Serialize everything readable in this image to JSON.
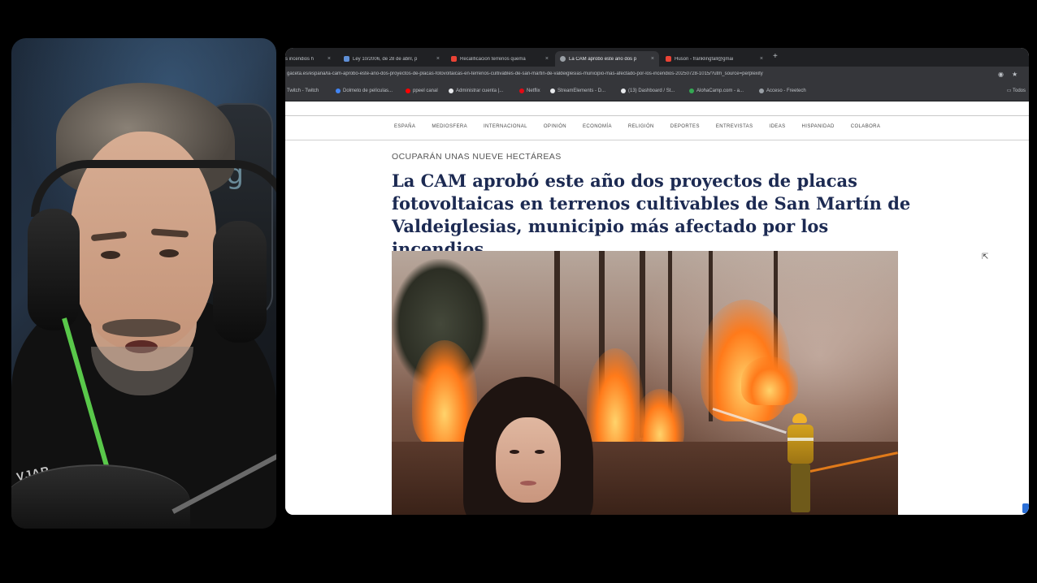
{
  "browser": {
    "tabs": [
      {
        "label": "s incendios h",
        "color": "#9aa0a6",
        "active": false
      },
      {
        "label": "Ley 10/2006, de 28 de abril, p",
        "color": "#5f8fd6",
        "active": false
      },
      {
        "label": "Recalificacion terrenos quema",
        "color": "#ea4335",
        "active": false
      },
      {
        "label": "La CAM aprobó este año dos p",
        "color": "#9aa0a6",
        "active": true
      },
      {
        "label": "Huson - franklingfall@gmai",
        "color": "#ea4335",
        "active": false
      }
    ],
    "close_glyph": "×",
    "new_tab_glyph": "+",
    "url": "gaceta.es/espana/la-cam-aprobo-este-ano-dos-proyectos-de-placas-fotovoltaicas-en-terrenos-cultivables-de-san-martin-de-valdeiglesias-municipio-mas-afectado-por-los-incendios-20250728-1015/?utm_source=perplexity",
    "bookmarks": [
      {
        "label": "Twitch - Twitch",
        "color": "#9146ff"
      },
      {
        "label": "Dolmeto de películas...",
        "color": "#4285f4"
      },
      {
        "label": "ppeel canal",
        "color": "#ff0000"
      },
      {
        "label": "Administrar cuenta |...",
        "color": "#e8eaed"
      },
      {
        "label": "Netflix",
        "color": "#e50914"
      },
      {
        "label": "StreamElements - D...",
        "color": "#e8eaed"
      },
      {
        "label": "(13) Dashboard / St...",
        "color": "#e8eaed"
      },
      {
        "label": "AlohaCamp.com - a...",
        "color": "#34a853"
      },
      {
        "label": "Acceso - Freetech",
        "color": "#9aa0a6"
      }
    ],
    "bookmarks_folder": "Todos"
  },
  "article": {
    "nav": [
      "ESPAÑA",
      "MEDIOSFERA",
      "INTERNACIONAL",
      "OPINIÓN",
      "ECONOMÍA",
      "RELIGIÓN",
      "DEPORTES",
      "ENTREVISTAS",
      "IDEAS",
      "HISPANIDAD",
      "COLABORA"
    ],
    "kicker": "OCUPARÁN UNAS NUEVE HECTÁREAS",
    "headline": "La CAM aprobó este año dos proyectos de placas fotovoltaicas en terrenos cultivables de San Martín de Valdeiglesias, municipio más afectado por los incendios"
  },
  "webcam": {
    "shirt_print": "VJAR"
  },
  "colors": {
    "headline": "#1c2a52",
    "tabbar": "#202124",
    "toolbar": "#35363a"
  },
  "icons": [
    "extension-icon",
    "star-icon",
    "folder-icon",
    "cursor-icon"
  ]
}
